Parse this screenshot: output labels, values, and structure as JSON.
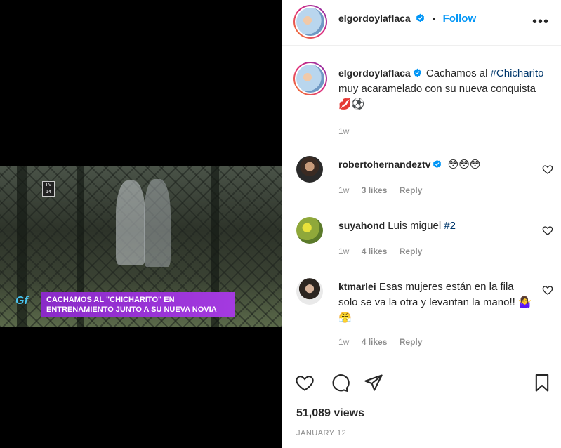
{
  "video": {
    "tv_rating": "TV 14",
    "caption_line1": "CACHAMOS AL \"CHICHARITO\" EN",
    "caption_line2": "ENTRENAMIENTO JUNTO A SU NUEVA NOVIA",
    "logo_text": "Gf"
  },
  "header": {
    "username": "elgordoylaflaca",
    "separator": "•",
    "follow_label": "Follow",
    "more_label": "•••"
  },
  "post": {
    "username": "elgordoylaflaca",
    "text_before": " Cachamos al ",
    "hashtag": "#Chicharito",
    "text_after": " muy acaramelado con su nueva conquista 💋⚽",
    "time": "1w"
  },
  "comments": [
    {
      "username": "robertohernandeztv",
      "verified": true,
      "text": "😳😳😳",
      "time": "1w",
      "likes": "3 likes",
      "reply": "Reply"
    },
    {
      "username": "suyahond",
      "verified": false,
      "text": "Luis miguel ",
      "hashtag": "#2",
      "time": "1w",
      "likes": "4 likes",
      "reply": "Reply"
    },
    {
      "username": "ktmarlei",
      "verified": false,
      "text": "Esas mujeres están en la fila solo se va la otra y levantan la mano!! 🤷‍♀️😤",
      "time": "1w",
      "likes": "4 likes",
      "reply": "Reply"
    }
  ],
  "stats": {
    "views": "51,089 views",
    "date": "JANUARY 12"
  },
  "icons": {
    "like": "heart-icon",
    "comment": "comment-icon",
    "share": "share-icon",
    "save": "bookmark-icon"
  },
  "colors": {
    "accent": "#0095f6",
    "hashtag": "#00376b",
    "muted": "#8e8e8e",
    "caption_bar": "#9b34d8"
  }
}
